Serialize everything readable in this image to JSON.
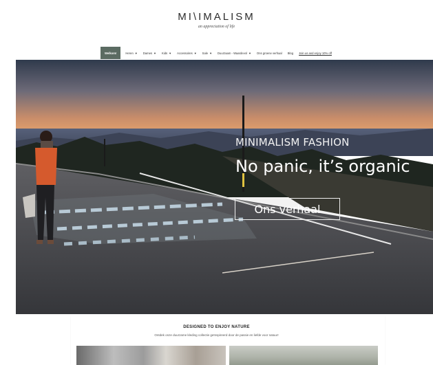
{
  "brand": {
    "logo": "MI\\IMALISM",
    "tagline": "an appreciation of life"
  },
  "nav": {
    "items": [
      {
        "label": "Welkom!",
        "active": true,
        "caret": false
      },
      {
        "label": "Heren",
        "caret": true
      },
      {
        "label": "Dames",
        "caret": true
      },
      {
        "label": "Kids",
        "caret": true
      },
      {
        "label": "Accessoires",
        "caret": true
      },
      {
        "label": "Sale",
        "caret": true
      },
      {
        "label": "Duurzaam - Waardevol",
        "caret": true
      },
      {
        "label": "Ons groene verhaal",
        "caret": false
      },
      {
        "label": "Blog",
        "caret": false
      },
      {
        "label": "Join us and enjoy 10% off",
        "caret": false,
        "underline": true
      }
    ]
  },
  "hero": {
    "kicker": "MINIMALISM FASHION",
    "title": "No panic, it’s organic",
    "button": "Ons verhaal"
  },
  "section": {
    "title": "DESIGNED TO ENJOY NATURE",
    "subtitle": "Ontdek onze duurzame kleding collectie geïnspireerd door de passie en liefde voor natuur!"
  }
}
